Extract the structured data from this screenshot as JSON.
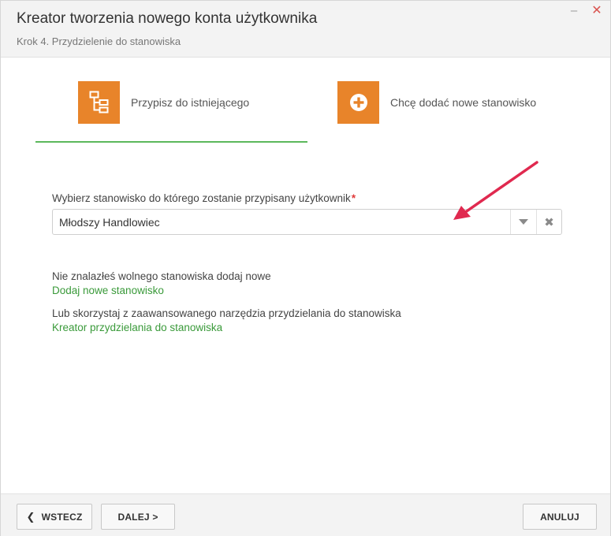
{
  "header": {
    "title": "Kreator tworzenia nowego konta użytkownika",
    "subtitle": "Krok 4. Przydzielenie do stanowiska",
    "minimize_glyph": "–",
    "close_glyph": "✕"
  },
  "choices": [
    {
      "label": "Przypisz do istniejącego",
      "icon": "hierarchy-icon",
      "selected": true
    },
    {
      "label": "Chcę dodać nowe stanowisko",
      "icon": "plus-circle-icon",
      "selected": false
    }
  ],
  "form": {
    "label": "Wybierz stanowisko do którego zostanie przypisany użytkownik",
    "required_mark": "*",
    "selected_value": "Młodszy Handlowiec",
    "clear_glyph": "✖"
  },
  "info": {
    "text1": "Nie znalazłeś wolnego stanowiska dodaj nowe",
    "link1": "Dodaj nowe stanowisko",
    "text2": "Lub skorzystaj z zaawansowanego narzędzia przydzielania do stanowiska",
    "link2": "Kreator przydzielania do stanowiska"
  },
  "footer": {
    "back_label": "WSTECZ",
    "back_glyph": "❮",
    "next_label": "DALEJ >",
    "cancel_label": "ANULUJ"
  },
  "colors": {
    "accent_orange": "#e8842a",
    "accent_green": "#5cb85c",
    "link_green": "#3a9a3a",
    "close_red": "#d9534f",
    "annotation_arrow": "#e0294f"
  }
}
